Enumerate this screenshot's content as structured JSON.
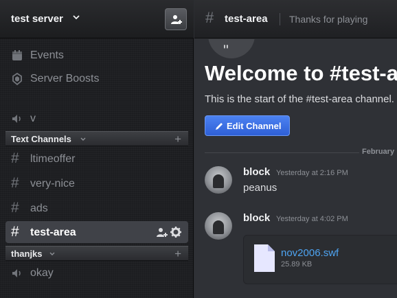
{
  "server": {
    "name": "test server",
    "invite_icon": "add-person-icon"
  },
  "nav": [
    {
      "label": "Events",
      "icon": "calendar-icon"
    },
    {
      "label": "Server Boosts",
      "icon": "boost-shield-icon"
    },
    {
      "label": "v",
      "icon": "speaker-icon"
    }
  ],
  "categories": {
    "text_channels": "Text Channels",
    "thanjks": "thanjks"
  },
  "channels": [
    {
      "label": "ltimeoffer"
    },
    {
      "label": "very-nice"
    },
    {
      "label": "ads"
    },
    {
      "label": "test-area",
      "active": true
    }
  ],
  "voice_channels": [
    {
      "label": "okay"
    }
  ],
  "header": {
    "channel": "test-area",
    "topic": "Thanks for playing"
  },
  "welcome": {
    "icon_glyph": "\"",
    "title": "Welcome to #test-area!",
    "subtitle": "This is the start of the #test-area channel.",
    "edit_button": "Edit Channel"
  },
  "date_divider": "February",
  "messages": [
    {
      "author": "block",
      "time": "Yesterday at 2:16 PM",
      "text": "peanus"
    },
    {
      "author": "block",
      "time": "Yesterday at 4:02 PM",
      "text": ""
    }
  ],
  "attachment": {
    "filename": "nov2006.swf",
    "size": "25.89 KB"
  },
  "colors": {
    "accent": "#3b6fe0",
    "link": "#4ea4f2",
    "sidebar_bg": "#1e1f22",
    "main_bg": "#2f3136"
  }
}
